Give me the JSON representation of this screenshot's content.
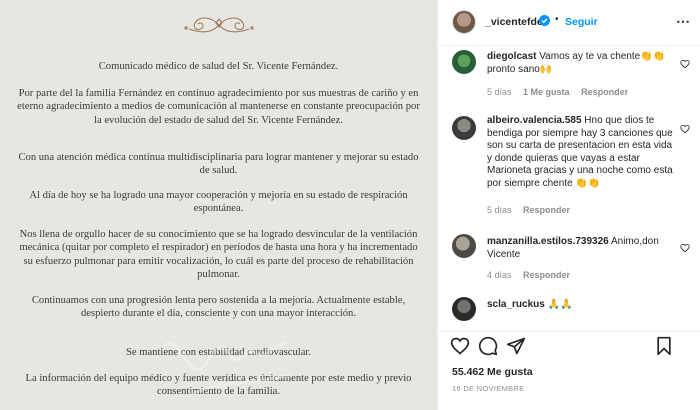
{
  "post": {
    "paragraphs": [
      "Comunicado médico de salud del Sr. Vicente Fernández.",
      "Por parte del la familia Fernández en contínuo agradecimiento por sus muestras de cariño y en eterno agradecimiento a medios de comunicación al mantenerse en constante preocupación por la evolución del estado de salud del Sr. Vicente Fernández.",
      "Con una atención médica contínua multidisciplinaria para lograr mantener y mejorar su estado de salud.",
      "Al día de hoy se ha logrado una mayor cooperación y mejoría en su estado de respiración espontánea.",
      "Nos llena de orgullo hacer de su conocimiento que se ha logrado desvincular de la ventilación mecánica (quitar por completo el respirador) en períodos de hasta una hora y ha incrementado su esfuerzo pulmonar para emitir vocalización, lo cuál es parte del proceso de rehabilitación pulmonar.",
      "Continuamos con una progresión lenta pero sostenida a la mejoría. Actualmente estable, despierto durante el día, consciente y con una mayor interacción.",
      "Se mantiene con estabilidad cardiovascular.",
      "La información del equipo médico y fuente verídica es únicamente por este medio y previo consentimiento de la familia."
    ]
  },
  "header": {
    "username": "_vicentefdez",
    "separator": "•",
    "follow_label": "Seguir",
    "more_icon": "more-horizontal-icon"
  },
  "comments": [
    {
      "user": "diegolcast",
      "text": "Vamos ay te va chente👏👏 pronto sano🙌",
      "time": "5 días",
      "likes": "1 Me gusta",
      "reply": "Responder"
    },
    {
      "user": "albeiro.valencia.585",
      "text": "Hno que dios te bendiga por siempre hay 3 canciones que son su carta de presentacion en esta vida y donde quieras que vayas a estar Marioneta gracias y una noche como esta por siempre chente 👏👏",
      "time": "5 días",
      "reply": "Responder"
    },
    {
      "user": "manzanilla.estilos.739326",
      "text": "Animo,don Vicente",
      "time": "4 días",
      "reply": "Responder"
    },
    {
      "user": "scla_ruckus",
      "text": "🙏🙏"
    }
  ],
  "actions": {
    "likes": "55.462 Me gusta",
    "date": "16 DE NOVIEMBRE"
  },
  "colors": {
    "accent": "#0095f6",
    "post_bg": "#e8e6e1",
    "meta_text": "#8e8e8e"
  }
}
